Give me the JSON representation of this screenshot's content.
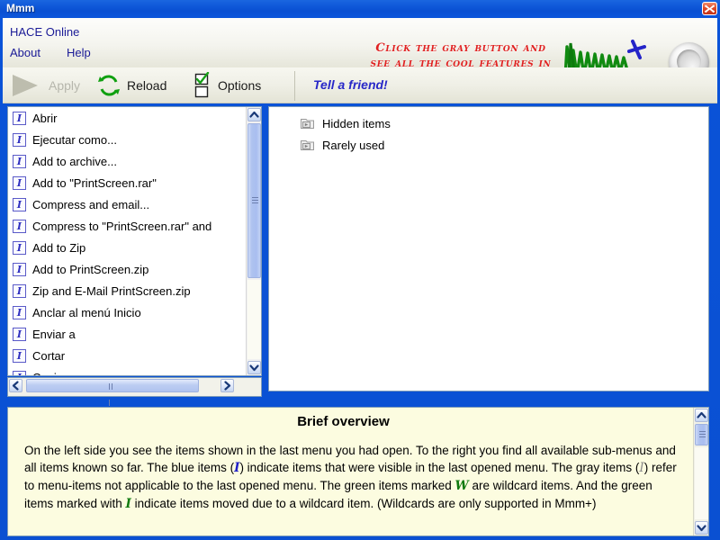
{
  "window": {
    "title": "Mmm",
    "close_label": "Close"
  },
  "banner": {
    "links": [
      {
        "name": "hace-online",
        "label": "HACE Online"
      },
      {
        "name": "about",
        "label": "About"
      },
      {
        "name": "help",
        "label": "Help"
      }
    ],
    "promo_line1": "Click the gray button and",
    "promo_line2": "see all the cool features in",
    "logo_text": "Mmm+",
    "gray_button_label": ""
  },
  "toolbar": {
    "apply_label": "Apply",
    "reload_label": "Reload",
    "options_label": "Options",
    "tell_friend_label": "Tell a friend!"
  },
  "left_panel": {
    "items": [
      {
        "icon": "blue-i-icon",
        "label": "Abrir"
      },
      {
        "icon": "blue-i-icon",
        "label": "Ejecutar como..."
      },
      {
        "icon": "blue-i-icon",
        "label": "Add to archive..."
      },
      {
        "icon": "blue-i-icon",
        "label": "Add to \"PrintScreen.rar\""
      },
      {
        "icon": "blue-i-icon",
        "label": "Compress and email..."
      },
      {
        "icon": "blue-i-icon",
        "label": "Compress to \"PrintScreen.rar\" and"
      },
      {
        "icon": "blue-i-icon",
        "label": "Add to Zip"
      },
      {
        "icon": "blue-i-icon",
        "label": "Add to PrintScreen.zip"
      },
      {
        "icon": "blue-i-icon",
        "label": "Zip and E-Mail PrintScreen.zip"
      },
      {
        "icon": "blue-i-icon",
        "label": "Anclar al menú Inicio"
      },
      {
        "icon": "blue-i-icon",
        "label": "Enviar a"
      },
      {
        "icon": "blue-i-icon",
        "label": "Cortar"
      },
      {
        "icon": "blue-i-icon",
        "label": "Copiar"
      }
    ],
    "icon_glyph": "I"
  },
  "right_panel": {
    "items": [
      {
        "icon": "submenu-folder-icon",
        "label": "Hidden items"
      },
      {
        "icon": "submenu-folder-icon",
        "label": "Rarely used"
      }
    ]
  },
  "info_panel": {
    "heading": "Brief overview",
    "paragraph_parts": {
      "p1": "On the left side you see the items shown in the last menu you had open. To the right you find all available sub-menus and all items known so far. The blue items (",
      "marker_blue": "I",
      "p2": ") indicate items that were visible in the last opened menu. The gray items (",
      "marker_gray": "I",
      "p3": ") refer to menu-items not applicable to the last opened menu. The green items marked ",
      "marker_w": "W",
      "p4": " are wildcard items. And the green items marked with ",
      "marker_green_i": "I",
      "p5": " indicate items moved due to a wildcard item. (Wildcards are only supported in Mmm+)"
    }
  },
  "colors": {
    "title_bar": "#0a50d2",
    "accent_blue": "#1a1a96",
    "promo_red": "#e02020",
    "logo_green": "#108a10",
    "logo_plus_blue": "#2424c8",
    "info_bg": "#fcfce0",
    "toolbar_bg": "#efefe6"
  }
}
